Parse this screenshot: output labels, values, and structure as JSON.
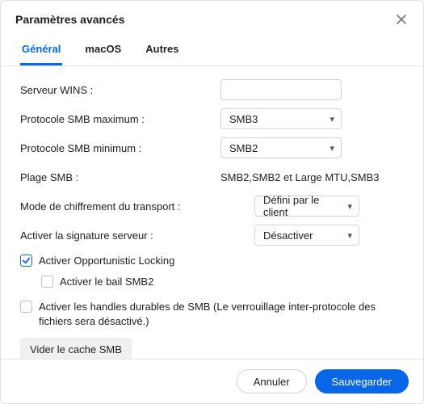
{
  "dialog": {
    "title": "Paramètres avancés",
    "close_aria": "Fermer"
  },
  "tabs": {
    "general": "Général",
    "macos": "macOS",
    "others": "Autres"
  },
  "fields": {
    "wins_label": "Serveur WINS :",
    "wins_value": "",
    "smb_max_label": "Protocole SMB maximum :",
    "smb_max_value": "SMB3",
    "smb_min_label": "Protocole SMB minimum :",
    "smb_min_value": "SMB2",
    "smb_range_label": "Plage SMB :",
    "smb_range_value": "SMB2,SMB2 et Large MTU,SMB3",
    "transport_enc_label": "Mode de chiffrement du transport :",
    "transport_enc_value": "Défini par le client",
    "server_sign_label": "Activer la signature serveur :",
    "server_sign_value": "Désactiver"
  },
  "checkboxes": {
    "oplock": "Activer Opportunistic Locking",
    "smb2_lease": "Activer le bail SMB2",
    "durable_handles": "Activer les handles durables de SMB (Le verrouillage inter-protocole des fichiers sera désactivé.)"
  },
  "actions": {
    "clear_cache": "Vider le cache SMB",
    "cancel": "Annuler",
    "save": "Sauvegarder"
  }
}
